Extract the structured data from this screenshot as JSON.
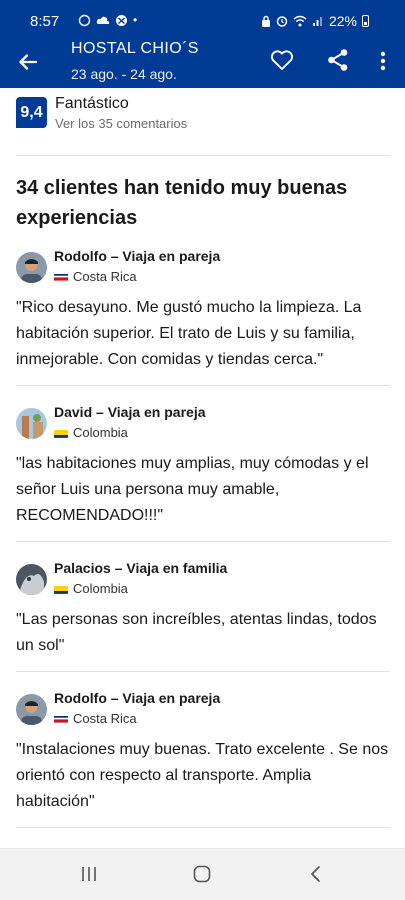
{
  "status_bar": {
    "time": "8:57",
    "battery": "22%"
  },
  "app_bar": {
    "title": "HOSTAL CHIO´S",
    "dates": "23 ago. - 24 ago."
  },
  "rating": {
    "score": "9,4",
    "label": "Fantástico",
    "comments_link": "Ver los 35 comentarios"
  },
  "heading": "34 clientes han tenido muy buenas experiencias",
  "reviews": [
    {
      "name": "Rodolfo – Viaja en pareja",
      "country": "Costa Rica",
      "flag": "costa-rica-flag",
      "text": "\"Rico desayuno. Me gustó mucho la limpieza. La habitación superior. El trato de Luis y su familia, inmejorable. Con comidas y tiendas cerca.\""
    },
    {
      "name": "David – Viaja en pareja",
      "country": "Colombia",
      "flag": "colombia-flag",
      "text": "\"las habitaciones muy amplias, muy cómodas y el señor Luis una persona muy amable, RECOMENDADO!!!\""
    },
    {
      "name": "Palacios – Viaja en familia",
      "country": "Colombia",
      "flag": "colombia-flag",
      "text": "\"Las personas son increíbles, atentas lindas, todos un sol\""
    },
    {
      "name": "Rodolfo – Viaja en pareja",
      "country": "Costa Rica",
      "flag": "costa-rica-flag",
      "text": "\"Instalaciones muy buenas. Trato excelente . Se nos orientó con respecto al transporte. Amplia habitación\""
    }
  ],
  "colors": {
    "brand_blue": "#003b95",
    "divider": "#e0e0e0"
  },
  "icons": {
    "back": "arrow-left-icon",
    "favorite": "heart-outline-icon",
    "share": "share-icon",
    "more": "more-vertical-icon",
    "nav_recent": "recent-apps-icon",
    "nav_home": "home-icon",
    "nav_back": "chevron-left-icon"
  }
}
